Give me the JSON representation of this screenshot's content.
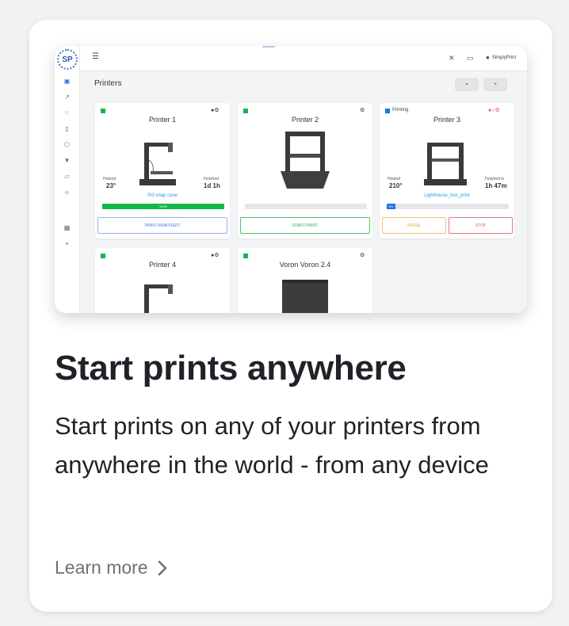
{
  "screenshot": {
    "logo_text": "SP",
    "user_name": "SimplyPrint",
    "page_title": "Printers",
    "printers": [
      {
        "name": "Printer 1",
        "status": "",
        "hotend_label": "Hotend",
        "hotend_value": "23°",
        "time_label": "Finished",
        "time_value": "1d 1h",
        "file_name": "Pi3 snap case",
        "progress": 100,
        "progress_label": "100%",
        "buttons": [
          "PRINT REMOVED?"
        ]
      },
      {
        "name": "Printer 2",
        "status": "",
        "buttons": [
          "START PRINT"
        ]
      },
      {
        "name": "Printer 3",
        "status": "Printing",
        "hotend_label": "Hotend",
        "hotend_value": "210°",
        "time_label": "Finished in",
        "time_value": "1h 47m",
        "file_name": "Lighthouse_test_print",
        "progress": 7,
        "progress_label": "5%",
        "buttons": [
          "PAUSE",
          "STOP"
        ]
      },
      {
        "name": "Printer 4"
      },
      {
        "name": "Voron Voron 2.4"
      }
    ],
    "colors": {
      "green": "#14b84a",
      "blue": "#1a73e8",
      "orange": "#f0b860",
      "red": "#e0585a",
      "link": "#2a9bd8"
    }
  },
  "heading": "Start prints anywhere",
  "description": "Start prints on any of your printers from anywhere in the world - from any device",
  "learn_more": "Learn more"
}
